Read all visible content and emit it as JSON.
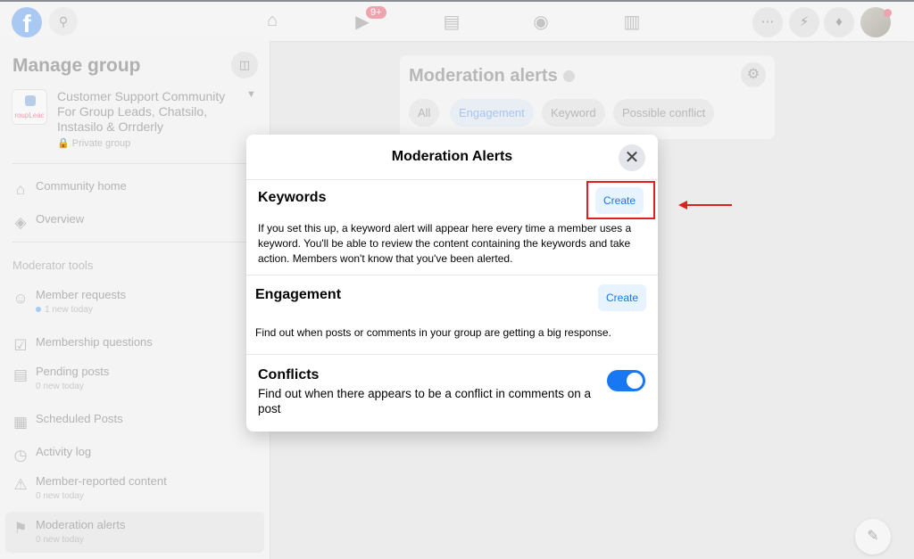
{
  "topbar": {
    "notification_badge": "9+"
  },
  "sidebar": {
    "title": "Manage group",
    "group": {
      "name": "Customer Support Community For Group Leads, Chatsilo, Instasilo & Orrderly",
      "logo_text": "roupLeac",
      "privacy": "Private group"
    },
    "items": [
      {
        "label": "Community home",
        "icon": "home-icon"
      },
      {
        "label": "Overview",
        "icon": "layers-icon"
      }
    ],
    "section_label": "Moderator tools",
    "tools": [
      {
        "label": "Member requests",
        "sub": "1 new today",
        "icon": "person-add-icon"
      },
      {
        "label": "Membership questions",
        "sub": "",
        "icon": "member-questions-icon"
      },
      {
        "label": "Pending posts",
        "sub": "0 new today",
        "icon": "pending-posts-icon"
      },
      {
        "label": "Scheduled Posts",
        "sub": "",
        "icon": "calendar-icon"
      },
      {
        "label": "Activity log",
        "sub": "",
        "icon": "clock-icon"
      },
      {
        "label": "Member-reported content",
        "sub": "0 new today",
        "icon": "alert-icon"
      },
      {
        "label": "Moderation alerts",
        "sub": "0 new today",
        "icon": "moderation-alert-icon"
      }
    ]
  },
  "main": {
    "title": "Moderation alerts",
    "filters": [
      "All",
      "Engagement",
      "Keyword",
      "Possible conflict"
    ],
    "selected_filter": "Engagement"
  },
  "modal": {
    "title": "Moderation Alerts",
    "sections": [
      {
        "heading": "Keywords",
        "button": "Create",
        "description": "If you set this up, a keyword alert will appear here every time a member uses a keyword. You'll be able to review the content containing the keywords and take action. Members won't know that you've been alerted."
      },
      {
        "heading": "Engagement",
        "button": "Create",
        "description": "Find out when posts or comments in your group are getting a big response."
      },
      {
        "heading": "Conflicts",
        "description": "Find out when there appears to be a conflict in comments on a post",
        "toggle_on": true
      }
    ]
  },
  "colors": {
    "accent": "#1877f2",
    "annotation": "#e41e1e"
  }
}
